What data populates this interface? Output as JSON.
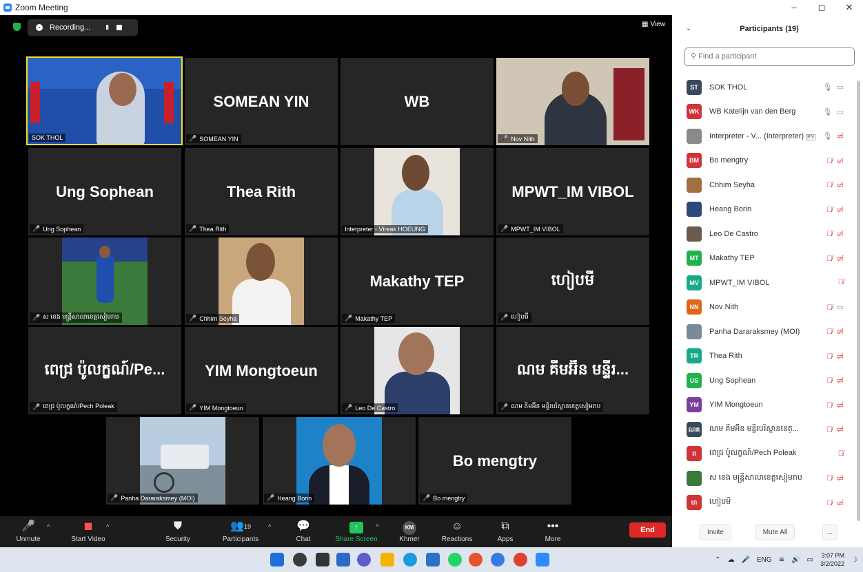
{
  "window": {
    "title": "Zoom Meeting",
    "controls": [
      "–",
      "◻",
      "✕"
    ]
  },
  "recording": {
    "label": "Recording...",
    "pause": "II"
  },
  "view_label": "View",
  "tiles": [
    {
      "name": "SOK THOL",
      "big": "",
      "video": true,
      "active": true,
      "muted": false
    },
    {
      "name": "SOMEAN YIN",
      "big": "SOMEAN YIN",
      "video": false,
      "muted": true
    },
    {
      "name": "",
      "big": "WB",
      "video": false,
      "muted": false
    },
    {
      "name": "Nov Nith",
      "big": "",
      "video": true,
      "muted": true
    },
    {
      "name": "Ung Sophean",
      "big": "Ung Sophean",
      "video": false,
      "muted": true
    },
    {
      "name": "Thea Rith",
      "big": "Thea Rith",
      "video": false,
      "muted": true
    },
    {
      "name": "Interpreter - Vireak HOEUNG",
      "big": "",
      "video": true,
      "muted": false
    },
    {
      "name": "MPWT_IM VIBOL",
      "big": "MPWT_IM VIBOL",
      "video": false,
      "muted": true
    },
    {
      "name": "ស ខេង មន្ត្រីសាលាខេត្តសៀមរាប",
      "big": "",
      "video": true,
      "muted": true
    },
    {
      "name": "Chhim Seyha",
      "big": "",
      "video": true,
      "muted": true
    },
    {
      "name": "Makathy TEP",
      "big": "Makathy TEP",
      "video": false,
      "muted": true
    },
    {
      "name": "ហៀបមី",
      "big": "ហៀបមី",
      "video": false,
      "muted": true
    },
    {
      "name": "ពេជ្រ ប៉ូលក្ខណ៍/Pech Poleak",
      "big": "ពេជ្រ ប៉ូលក្ខណ៍/Pe...",
      "video": false,
      "muted": true
    },
    {
      "name": "YIM Mongtoeun",
      "big": "YIM Mongtoeun",
      "video": false,
      "muted": true
    },
    {
      "name": "Leo De Castro",
      "big": "",
      "video": true,
      "muted": true
    },
    {
      "name": "ណម គីមអ៊ីន មន្ទីរបរិស្ថានខេត្តសៀមរាប",
      "big": "ណម គីមអ៊ីន មន្ទីរ...",
      "video": false,
      "muted": true
    },
    {
      "name": "Panha Dararaksmey (MOI)",
      "big": "",
      "video": true,
      "muted": true
    },
    {
      "name": "Heang Borin",
      "big": "",
      "video": true,
      "muted": true
    },
    {
      "name": "Bo mengtry",
      "big": "Bo mengtry",
      "video": false,
      "muted": true
    }
  ],
  "toolbar": {
    "unmute": "Unmute",
    "start_video": "Start Video",
    "security": "Security",
    "participants": "Participants",
    "participants_count": "19",
    "chat": "Chat",
    "share_screen": "Share Screen",
    "khmer": "Khmer",
    "khmer_badge": "KM",
    "reactions": "Reactions",
    "apps": "Apps",
    "more": "More",
    "end": "End"
  },
  "panel": {
    "title": "Participants (19)",
    "search_placeholder": "Find a participant",
    "participants": [
      {
        "initials": "ST",
        "color": "#3a4a5c",
        "name": "SOK THOL",
        "mic": "on",
        "video": "on"
      },
      {
        "initials": "WK",
        "color": "#d13438",
        "name": "WB Katelijn van den Berg",
        "mic": "on",
        "video": "on"
      },
      {
        "initials": "",
        "color": "#8a8a8a",
        "name": "Interpreter - V... (Interpreter)",
        "badge": "EN",
        "mic": "on",
        "video": "off"
      },
      {
        "initials": "BM",
        "color": "#d13438",
        "name": "Bo mengtry",
        "mic": "off",
        "video": "off"
      },
      {
        "initials": "",
        "color": "#a07040",
        "name": "Chhim Seyha",
        "mic": "off",
        "video": "off"
      },
      {
        "initials": "",
        "color": "#2c4a7a",
        "name": "Heang Borin",
        "mic": "off",
        "video": "off"
      },
      {
        "initials": "",
        "color": "#6a5a50",
        "name": "Leo De Castro",
        "mic": "off",
        "video": "off"
      },
      {
        "initials": "MT",
        "color": "#20b14a",
        "name": "Makathy TEP",
        "mic": "off",
        "video": "off"
      },
      {
        "initials": "MV",
        "color": "#1aa88a",
        "name": "MPWT_IM VIBOL",
        "mic": "off",
        "video": "none"
      },
      {
        "initials": "NN",
        "color": "#e0661b",
        "name": "Nov Nith",
        "mic": "off",
        "video": "on"
      },
      {
        "initials": "",
        "color": "#7a8a9a",
        "name": "Panha Dararaksmey (MOI)",
        "mic": "off",
        "video": "off"
      },
      {
        "initials": "TR",
        "color": "#1aa88a",
        "name": "Thea Rith",
        "mic": "off",
        "video": "off"
      },
      {
        "initials": "US",
        "color": "#20b14a",
        "name": "Ung Sophean",
        "mic": "off",
        "video": "off"
      },
      {
        "initials": "YM",
        "color": "#7b3fa0",
        "name": "YIM Mongtoeun",
        "mic": "off",
        "video": "off"
      },
      {
        "initials": "ណគ",
        "color": "#3a4a5c",
        "name": "ណម គីមអ៊ីន មន្ទីរបរិស្ថានខេត្...",
        "mic": "off",
        "video": "off"
      },
      {
        "initials": "ព",
        "color": "#d13438",
        "name": "ពេជ្រ ប៉ូលក្ខណ៍/Pech Poleak",
        "mic": "off",
        "video": "none"
      },
      {
        "initials": "",
        "color": "#3a7a3a",
        "name": "ស ខេង មន្ត្រីសាលាខេត្តសៀមរាប",
        "mic": "off",
        "video": "off"
      },
      {
        "initials": "ហ",
        "color": "#d13438",
        "name": "ហៀបមី",
        "mic": "off",
        "video": "off"
      }
    ],
    "invite": "Invite",
    "mute_all": "Mute All",
    "more": "..."
  },
  "taskbar": {
    "lang": "ENG",
    "time": "3:07 PM",
    "date": "3/2/2022"
  }
}
